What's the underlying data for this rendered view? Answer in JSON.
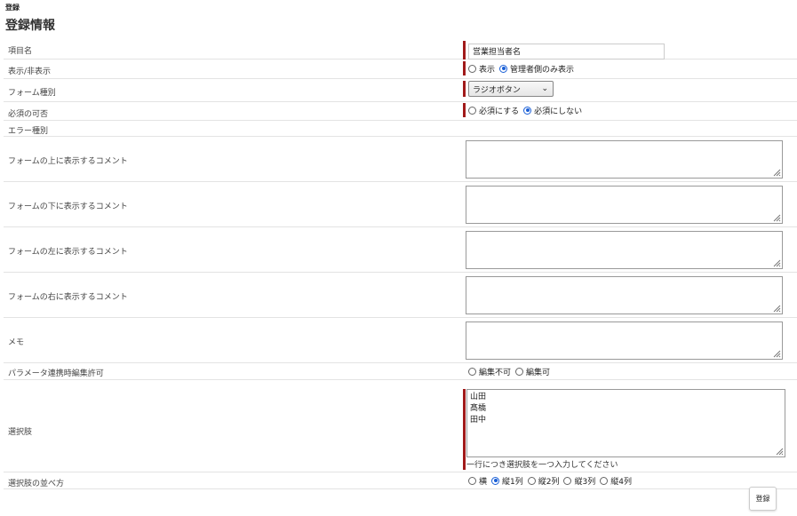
{
  "header": {
    "breadcrumb": "登録",
    "title": "登録情報"
  },
  "fields": {
    "item_name": {
      "label": "項目名",
      "value": "営業担当者名"
    },
    "display": {
      "label": "表示/非表示",
      "options": [
        "表示",
        "管理者側のみ表示"
      ],
      "selected": 1
    },
    "form_type": {
      "label": "フォーム種別",
      "value": "ラジオボタン"
    },
    "required": {
      "label": "必須の可否",
      "options": [
        "必須にする",
        "必須にしない"
      ],
      "selected": 1
    },
    "error_type": {
      "label": "エラー種別"
    },
    "comment_top": {
      "label": "フォームの上に表示するコメント"
    },
    "comment_bottom": {
      "label": "フォームの下に表示するコメント"
    },
    "comment_left": {
      "label": "フォームの左に表示するコメント"
    },
    "comment_right": {
      "label": "フォームの右に表示するコメント"
    },
    "memo": {
      "label": "メモ"
    },
    "param_edit": {
      "label": "パラメータ連携時編集許可",
      "options": [
        "編集不可",
        "編集可"
      ],
      "selected": -1
    },
    "choices": {
      "label": "選択肢",
      "lines": [
        "山田",
        "髙橋",
        "田中"
      ],
      "hint": "一行につき選択肢を一つ入力してください"
    },
    "choice_layout": {
      "label": "選択肢の並べ方",
      "options": [
        "横",
        "縦1列",
        "縦2列",
        "縦3列",
        "縦4列"
      ],
      "selected": 1
    }
  },
  "submit_label": "登録"
}
